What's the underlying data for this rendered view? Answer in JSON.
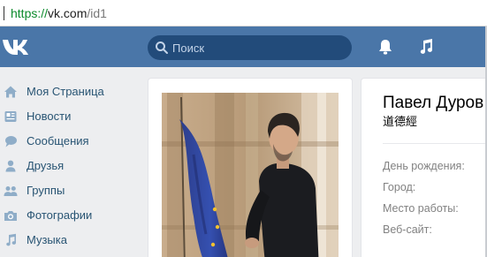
{
  "browser": {
    "url_scheme": "https://",
    "url_host": "vk.com",
    "url_path": "/id1"
  },
  "header": {
    "logo_icon": "vk-logo-icon",
    "search_placeholder": "Поиск",
    "notifications_icon": "bell-icon",
    "music_icon": "music-note-icon",
    "background": "#4a76a8"
  },
  "sidebar": {
    "items": [
      {
        "label": "Моя Страница",
        "icon": "home-icon"
      },
      {
        "label": "Новости",
        "icon": "news-icon"
      },
      {
        "label": "Сообщения",
        "icon": "chat-bubble-icon"
      },
      {
        "label": "Друзья",
        "icon": "person-icon"
      },
      {
        "label": "Группы",
        "icon": "people-icon"
      },
      {
        "label": "Фотографии",
        "icon": "camera-icon"
      },
      {
        "label": "Музыка",
        "icon": "music-note-icon"
      }
    ]
  },
  "profile": {
    "name": "Павел Дуров",
    "status": "道德經",
    "fields": [
      {
        "label": "День рождения:"
      },
      {
        "label": "Город:"
      },
      {
        "label": "Место работы:"
      },
      {
        "label": "Веб-сайт:"
      }
    ]
  },
  "colors": {
    "accent": "#4a76a8",
    "link": "#285473",
    "page_bg": "#edeef0"
  }
}
